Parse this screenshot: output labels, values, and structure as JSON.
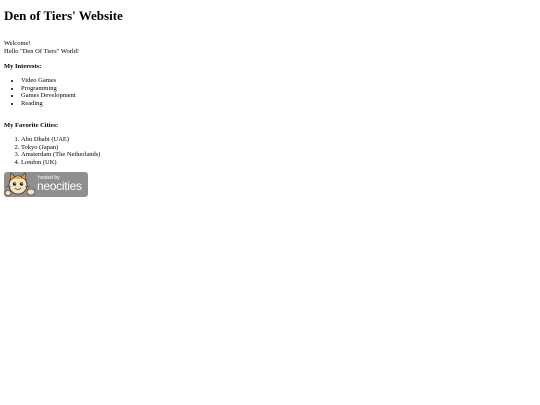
{
  "page": {
    "title": "Den of Tiers' Website",
    "welcome": "Welcome!",
    "hello": "Hello \"Den Of Tiers\" World!"
  },
  "interests": {
    "heading": "My Interests:",
    "items": [
      "Video Games",
      "Programming",
      "Games Development",
      "Reading"
    ]
  },
  "cities": {
    "heading": "My Favorite Cities:",
    "items": [
      "Abu Dhabi (UAE)",
      "Tokyo (Japan)",
      "Amsterdam (The Netherlands)",
      "London (UK)"
    ]
  },
  "badge": {
    "small_text": "hosted by",
    "brand_text": "neocities",
    "icon": "neocities-cat-icon",
    "background_color": "#8f8f8f"
  }
}
